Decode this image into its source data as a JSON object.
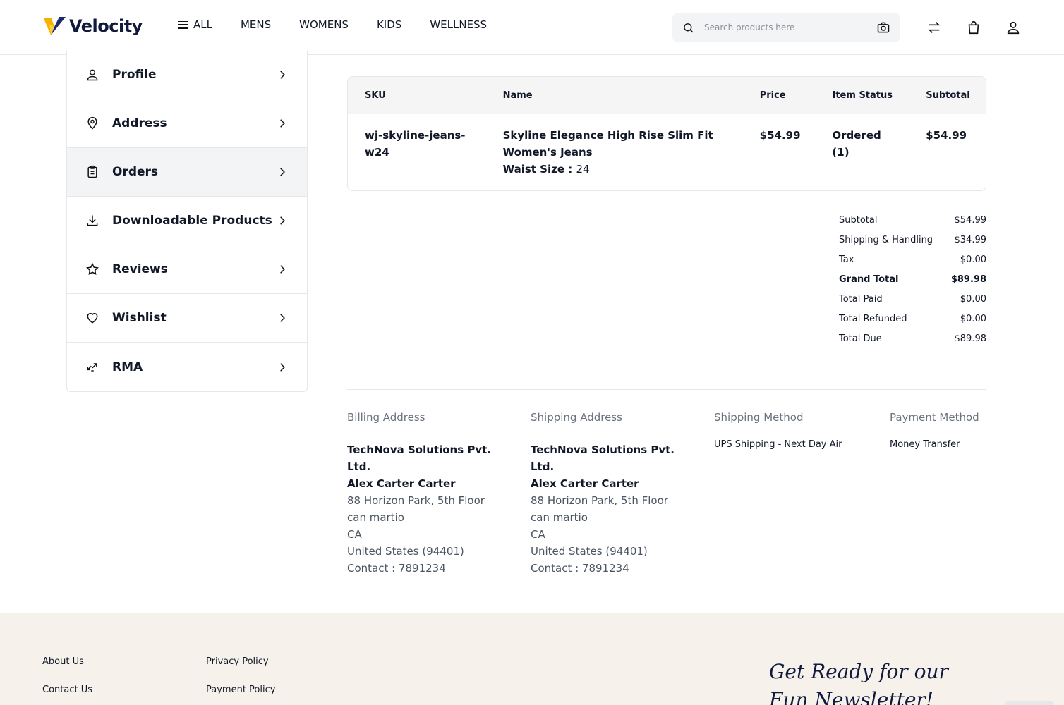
{
  "brand": {
    "name": "Velocity",
    "accent": "#f5b000",
    "navy": "#0f1a3c"
  },
  "nav": {
    "all": "ALL",
    "items": [
      "MENS",
      "WOMENS",
      "KIDS",
      "WELLNESS"
    ]
  },
  "search": {
    "placeholder": "Search products here"
  },
  "header_icons": [
    "compare-icon",
    "cart-icon",
    "account-icon"
  ],
  "sidebar": {
    "items": [
      {
        "label": "Profile",
        "icon": "user-icon"
      },
      {
        "label": "Address",
        "icon": "location-icon"
      },
      {
        "label": "Orders",
        "icon": "clipboard-icon",
        "active": true
      },
      {
        "label": "Downloadable Products",
        "icon": "download-icon"
      },
      {
        "label": "Reviews",
        "icon": "star-icon"
      },
      {
        "label": "Wishlist",
        "icon": "heart-icon"
      },
      {
        "label": "RMA",
        "icon": "rma-icon"
      }
    ]
  },
  "items_table": {
    "headers": [
      "SKU",
      "Name",
      "Price",
      "Item Status",
      "Subtotal"
    ],
    "rows": [
      {
        "sku": "wj-skyline-jeans-w24",
        "name": "Skyline Elegance High Rise Slim Fit Women's Jeans",
        "attr_label": "Waist Size :",
        "attr_value": "24",
        "price": "$54.99",
        "status": "Ordered (1)",
        "subtotal": "$54.99"
      }
    ]
  },
  "totals": [
    {
      "label": "Subtotal",
      "value": "$54.99",
      "bold": false
    },
    {
      "label": "Shipping & Handling",
      "value": "$34.99",
      "bold": false
    },
    {
      "label": "Tax",
      "value": "$0.00",
      "bold": false
    },
    {
      "label": "Grand Total",
      "value": "$89.98",
      "bold": true
    },
    {
      "label": "Total Paid",
      "value": "$0.00",
      "bold": false
    },
    {
      "label": "Total Refunded",
      "value": "$0.00",
      "bold": false
    },
    {
      "label": "Total Due",
      "value": "$89.98",
      "bold": false
    }
  ],
  "billing": {
    "title": "Billing Address",
    "company": "TechNova Solutions Pvt. Ltd.",
    "name": "Alex Carter Carter",
    "street": "88 Horizon Park, 5th Floor",
    "city": "can martio",
    "state": "CA",
    "country": "United States (94401)",
    "contact": "Contact : 7891234"
  },
  "shipping": {
    "title": "Shipping Address",
    "company": "TechNova Solutions Pvt. Ltd.",
    "name": "Alex Carter Carter",
    "street": "88 Horizon Park, 5th Floor",
    "city": "can martio",
    "state": "CA",
    "country": "United States (94401)",
    "contact": "Contact : 7891234"
  },
  "shipping_method": {
    "title": "Shipping Method",
    "value": "UPS Shipping - Next Day Air"
  },
  "payment_method": {
    "title": "Payment Method",
    "value": "Money Transfer"
  },
  "footer": {
    "col1": [
      "About Us",
      "Contact Us"
    ],
    "col2": [
      "Privacy Policy",
      "Payment Policy"
    ],
    "newsletter": "Get Ready for our Fun Newsletter!"
  }
}
